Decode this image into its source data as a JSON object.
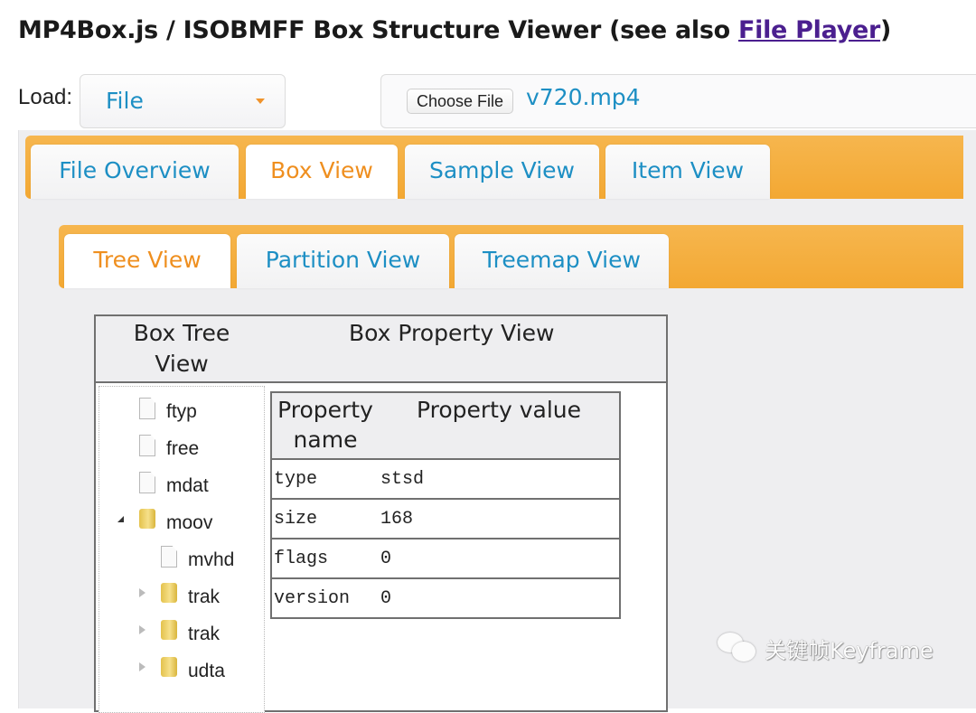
{
  "header": {
    "title": "MP4Box.js / ISOBMFF Box Structure Viewer (see also ",
    "link_text": "File Player",
    "title_end": ")"
  },
  "load": {
    "label": "Load:",
    "selected": "File",
    "choose_button": "Choose File",
    "file_name": "v720.mp4"
  },
  "main_tabs": [
    {
      "label": "File Overview",
      "active": false
    },
    {
      "label": "Box View",
      "active": true
    },
    {
      "label": "Sample View",
      "active": false
    },
    {
      "label": "Item View",
      "active": false
    }
  ],
  "sub_tabs": [
    {
      "label": "Tree View",
      "active": true
    },
    {
      "label": "Partition View",
      "active": false
    },
    {
      "label": "Treemap View",
      "active": false
    }
  ],
  "box_table": {
    "tree_header": "Box Tree View",
    "property_header": "Box Property View"
  },
  "tree": [
    {
      "label": "ftyp",
      "type": "file",
      "depth": 0
    },
    {
      "label": "free",
      "type": "file",
      "depth": 0
    },
    {
      "label": "mdat",
      "type": "file",
      "depth": 0
    },
    {
      "label": "moov",
      "type": "folder",
      "depth": 0,
      "expanded": true
    },
    {
      "label": "mvhd",
      "type": "file",
      "depth": 1
    },
    {
      "label": "trak",
      "type": "folder",
      "depth": 1,
      "expanded": false
    },
    {
      "label": "trak",
      "type": "folder",
      "depth": 1,
      "expanded": false
    },
    {
      "label": "udta",
      "type": "folder",
      "depth": 1,
      "expanded": false
    }
  ],
  "properties": {
    "col_name": "Property name",
    "col_value": "Property value",
    "rows": [
      {
        "name": "type",
        "value": "stsd"
      },
      {
        "name": "size",
        "value": "168"
      },
      {
        "name": "flags",
        "value": "0"
      },
      {
        "name": "version",
        "value": "0"
      }
    ]
  },
  "watermark": {
    "text": "关键帧Keyframe"
  },
  "colors": {
    "accent_orange": "#f3a833",
    "tab_text_blue": "#1d8fc4",
    "active_tab_orange": "#ef8f1f",
    "link_purple": "#4b1f8f"
  }
}
